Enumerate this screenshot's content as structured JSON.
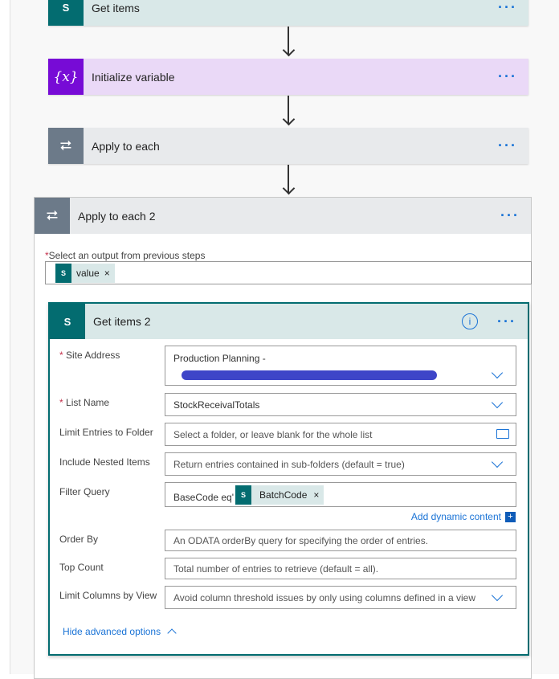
{
  "steps": [
    {
      "title": "Get items",
      "icon": "sharepoint-icon",
      "bg": "#d9e8e8",
      "icon_color": "#036c70"
    },
    {
      "title": "Initialize variable",
      "icon": "variable-icon",
      "icon_text": "{x}",
      "bg": "#ead9f7",
      "icon_color": "#770bd6"
    },
    {
      "title": "Apply to each",
      "icon": "loop-icon",
      "bg": "#e8eaec",
      "icon_color": "#6c7a89"
    }
  ],
  "more_label": "···",
  "loop2": {
    "title": "Apply to each 2",
    "output_label": "Select an output from previous steps",
    "token": "value",
    "remove": "×"
  },
  "get_items2": {
    "title": "Get items 2",
    "info": "i",
    "fields": {
      "site_address": {
        "label": "Site Address",
        "value": "Production Planning -"
      },
      "list_name": {
        "label": "List Name",
        "value": "StockReceivalTotals"
      },
      "folder": {
        "label": "Limit Entries to Folder",
        "placeholder": "Select a folder, or leave blank for the whole list"
      },
      "nested": {
        "label": "Include Nested Items",
        "placeholder": "Return entries contained in sub-folders (default = true)"
      },
      "filter": {
        "label": "Filter Query",
        "prefix": "BaseCode eq'",
        "token": "BatchCode"
      },
      "order": {
        "label": "Order By",
        "placeholder": "An ODATA orderBy query for specifying the order of entries."
      },
      "top": {
        "label": "Top Count",
        "placeholder": "Total number of entries to retrieve (default = all)."
      },
      "view": {
        "label": "Limit Columns by View",
        "placeholder": "Avoid column threshold issues by only using columns defined in a view"
      }
    },
    "required_mark": "*",
    "add_dynamic": "Add dynamic content",
    "hide_advanced": "Hide advanced options"
  },
  "colors": {
    "accent": "#1a73d6",
    "teal": "#036c70",
    "redaction": "#3e45c8"
  }
}
